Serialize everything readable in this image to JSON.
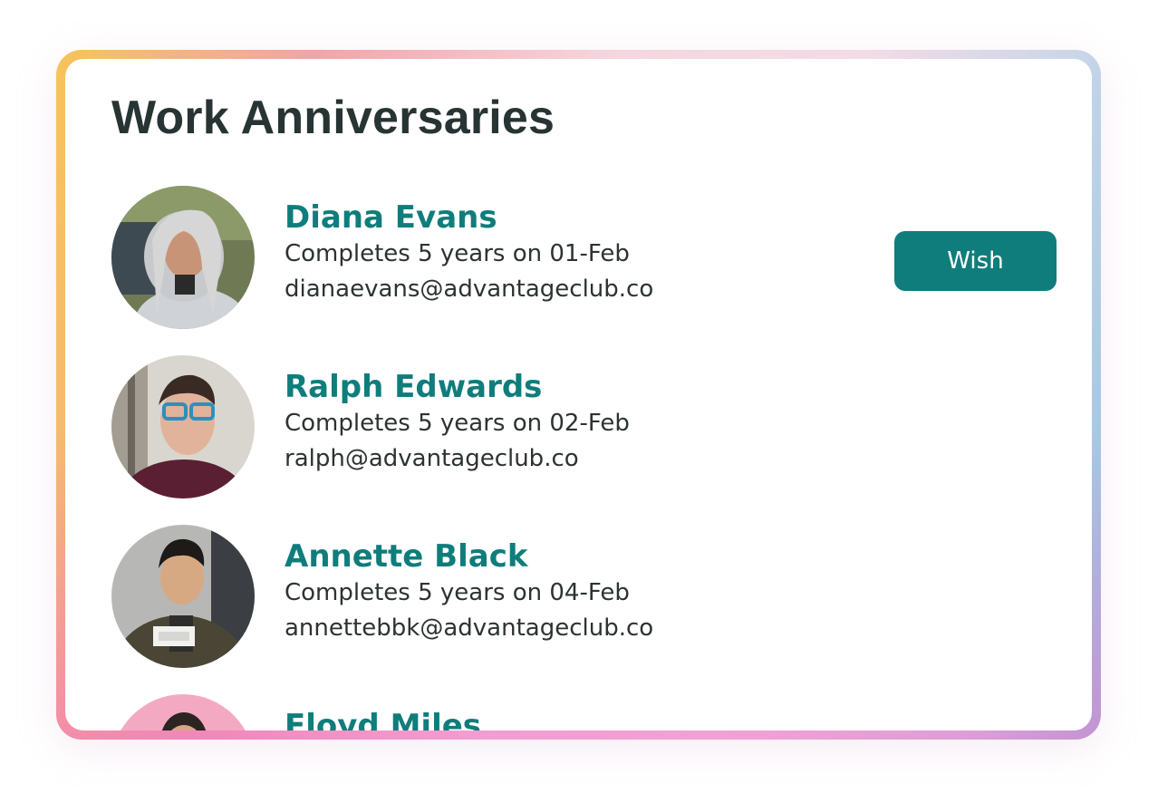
{
  "card": {
    "title": "Work Anniversaries"
  },
  "people": [
    {
      "name": "Diana Evans",
      "milestone": "Completes 5 years on 01-Feb",
      "email": "dianaevans@advantageclub.co"
    },
    {
      "name": "Ralph Edwards",
      "milestone": "Completes 5 years on 02-Feb",
      "email": "ralph@advantageclub.co"
    },
    {
      "name": "Annette Black",
      "milestone": "Completes 5 years on 04-Feb",
      "email": "annettebbk@advantageclub.co"
    },
    {
      "name": "Floyd Miles"
    }
  ],
  "actions": {
    "wish_label": "Wish"
  },
  "colors": {
    "accent": "#0f7d7b",
    "title_text": "#273433",
    "body_text": "#2c3332"
  }
}
